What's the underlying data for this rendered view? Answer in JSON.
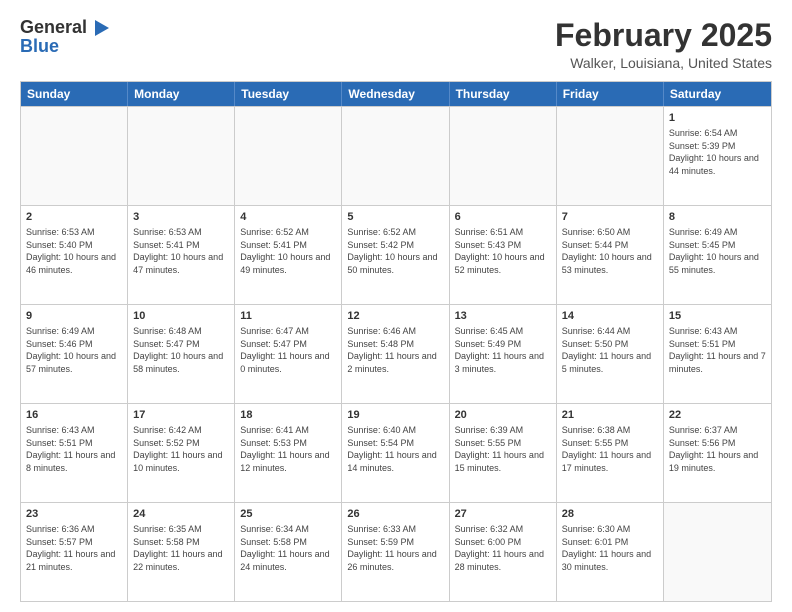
{
  "header": {
    "logo_line1": "General",
    "logo_line2": "Blue",
    "month_title": "February 2025",
    "location": "Walker, Louisiana, United States"
  },
  "weekdays": [
    "Sunday",
    "Monday",
    "Tuesday",
    "Wednesday",
    "Thursday",
    "Friday",
    "Saturday"
  ],
  "rows": [
    [
      {
        "day": "",
        "text": ""
      },
      {
        "day": "",
        "text": ""
      },
      {
        "day": "",
        "text": ""
      },
      {
        "day": "",
        "text": ""
      },
      {
        "day": "",
        "text": ""
      },
      {
        "day": "",
        "text": ""
      },
      {
        "day": "1",
        "text": "Sunrise: 6:54 AM\nSunset: 5:39 PM\nDaylight: 10 hours and 44 minutes."
      }
    ],
    [
      {
        "day": "2",
        "text": "Sunrise: 6:53 AM\nSunset: 5:40 PM\nDaylight: 10 hours and 46 minutes."
      },
      {
        "day": "3",
        "text": "Sunrise: 6:53 AM\nSunset: 5:41 PM\nDaylight: 10 hours and 47 minutes."
      },
      {
        "day": "4",
        "text": "Sunrise: 6:52 AM\nSunset: 5:41 PM\nDaylight: 10 hours and 49 minutes."
      },
      {
        "day": "5",
        "text": "Sunrise: 6:52 AM\nSunset: 5:42 PM\nDaylight: 10 hours and 50 minutes."
      },
      {
        "day": "6",
        "text": "Sunrise: 6:51 AM\nSunset: 5:43 PM\nDaylight: 10 hours and 52 minutes."
      },
      {
        "day": "7",
        "text": "Sunrise: 6:50 AM\nSunset: 5:44 PM\nDaylight: 10 hours and 53 minutes."
      },
      {
        "day": "8",
        "text": "Sunrise: 6:49 AM\nSunset: 5:45 PM\nDaylight: 10 hours and 55 minutes."
      }
    ],
    [
      {
        "day": "9",
        "text": "Sunrise: 6:49 AM\nSunset: 5:46 PM\nDaylight: 10 hours and 57 minutes."
      },
      {
        "day": "10",
        "text": "Sunrise: 6:48 AM\nSunset: 5:47 PM\nDaylight: 10 hours and 58 minutes."
      },
      {
        "day": "11",
        "text": "Sunrise: 6:47 AM\nSunset: 5:47 PM\nDaylight: 11 hours and 0 minutes."
      },
      {
        "day": "12",
        "text": "Sunrise: 6:46 AM\nSunset: 5:48 PM\nDaylight: 11 hours and 2 minutes."
      },
      {
        "day": "13",
        "text": "Sunrise: 6:45 AM\nSunset: 5:49 PM\nDaylight: 11 hours and 3 minutes."
      },
      {
        "day": "14",
        "text": "Sunrise: 6:44 AM\nSunset: 5:50 PM\nDaylight: 11 hours and 5 minutes."
      },
      {
        "day": "15",
        "text": "Sunrise: 6:43 AM\nSunset: 5:51 PM\nDaylight: 11 hours and 7 minutes."
      }
    ],
    [
      {
        "day": "16",
        "text": "Sunrise: 6:43 AM\nSunset: 5:51 PM\nDaylight: 11 hours and 8 minutes."
      },
      {
        "day": "17",
        "text": "Sunrise: 6:42 AM\nSunset: 5:52 PM\nDaylight: 11 hours and 10 minutes."
      },
      {
        "day": "18",
        "text": "Sunrise: 6:41 AM\nSunset: 5:53 PM\nDaylight: 11 hours and 12 minutes."
      },
      {
        "day": "19",
        "text": "Sunrise: 6:40 AM\nSunset: 5:54 PM\nDaylight: 11 hours and 14 minutes."
      },
      {
        "day": "20",
        "text": "Sunrise: 6:39 AM\nSunset: 5:55 PM\nDaylight: 11 hours and 15 minutes."
      },
      {
        "day": "21",
        "text": "Sunrise: 6:38 AM\nSunset: 5:55 PM\nDaylight: 11 hours and 17 minutes."
      },
      {
        "day": "22",
        "text": "Sunrise: 6:37 AM\nSunset: 5:56 PM\nDaylight: 11 hours and 19 minutes."
      }
    ],
    [
      {
        "day": "23",
        "text": "Sunrise: 6:36 AM\nSunset: 5:57 PM\nDaylight: 11 hours and 21 minutes."
      },
      {
        "day": "24",
        "text": "Sunrise: 6:35 AM\nSunset: 5:58 PM\nDaylight: 11 hours and 22 minutes."
      },
      {
        "day": "25",
        "text": "Sunrise: 6:34 AM\nSunset: 5:58 PM\nDaylight: 11 hours and 24 minutes."
      },
      {
        "day": "26",
        "text": "Sunrise: 6:33 AM\nSunset: 5:59 PM\nDaylight: 11 hours and 26 minutes."
      },
      {
        "day": "27",
        "text": "Sunrise: 6:32 AM\nSunset: 6:00 PM\nDaylight: 11 hours and 28 minutes."
      },
      {
        "day": "28",
        "text": "Sunrise: 6:30 AM\nSunset: 6:01 PM\nDaylight: 11 hours and 30 minutes."
      },
      {
        "day": "",
        "text": ""
      }
    ]
  ]
}
